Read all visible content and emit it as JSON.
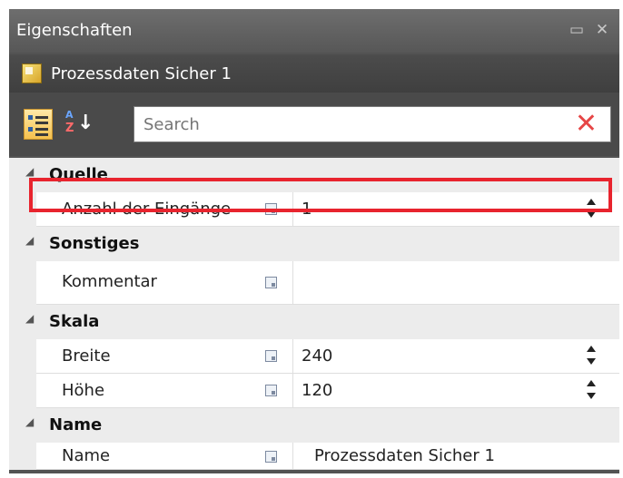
{
  "window": {
    "title": "Eigenschaften",
    "restore_glyph": "▭",
    "close_glyph": "✕"
  },
  "object": {
    "icon": "process-data-icon",
    "name": "Prozessdaten Sicher 1"
  },
  "toolbar": {
    "categorized_icon": "categorized-view-icon",
    "sort_icon": "sort-alphabetical-icon",
    "sort_a": "A",
    "sort_z": "Z",
    "sort_arrow": "↓",
    "search_placeholder": "Search",
    "clear_glyph": "✕"
  },
  "grid": {
    "categories": [
      {
        "label": "Quelle",
        "properties": [
          {
            "name": "Anzahl der Eingänge",
            "value": "1",
            "spinner": true,
            "highlighted": true
          }
        ]
      },
      {
        "label": "Sonstiges",
        "properties": [
          {
            "name": "Kommentar",
            "value": "",
            "spinner": false
          }
        ]
      },
      {
        "label": "Skala",
        "properties": [
          {
            "name": "Breite",
            "value": "240",
            "spinner": true
          },
          {
            "name": "Höhe",
            "value": "120",
            "spinner": true
          }
        ]
      },
      {
        "label": "Name",
        "properties": [
          {
            "name": "Name",
            "value": "Prozessdaten Sicher 1",
            "spinner": false
          }
        ]
      }
    ],
    "expand_glyph": "◢"
  },
  "colors": {
    "highlight": "#e8242e",
    "panel_bg": "#535353",
    "category_bg": "#ececec",
    "clear_button": "#e64646"
  }
}
